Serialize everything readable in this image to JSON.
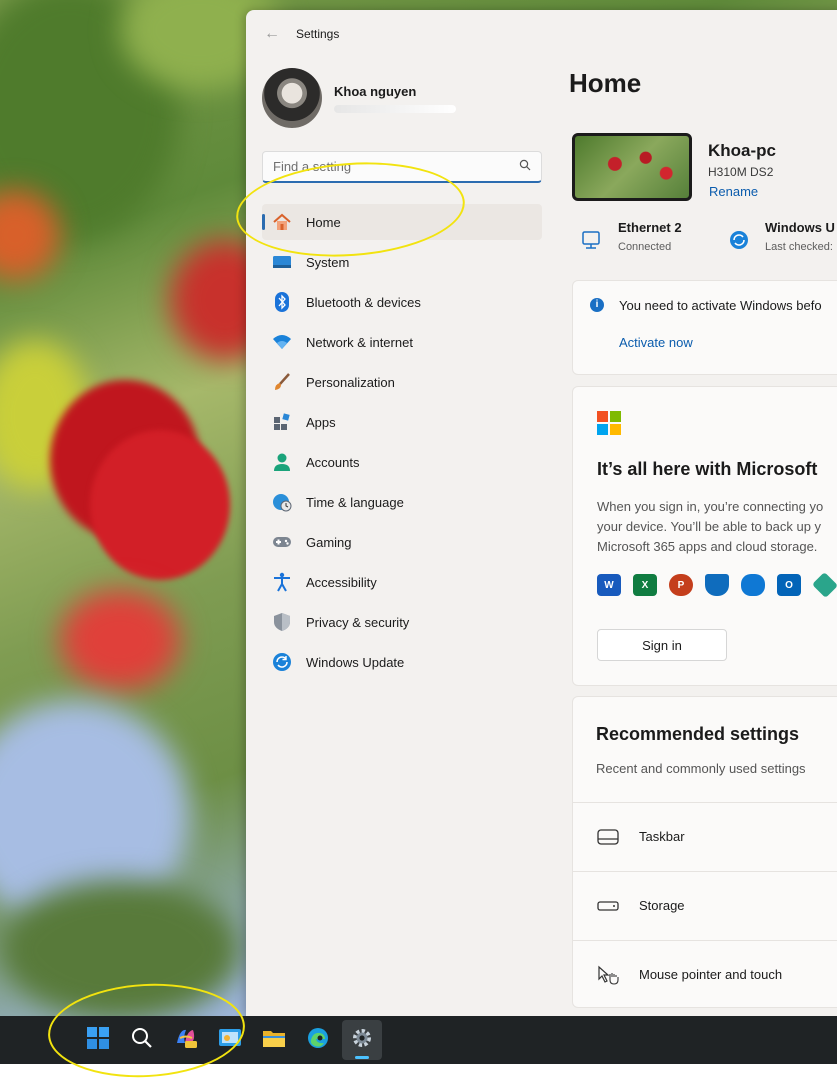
{
  "window": {
    "title": "Settings"
  },
  "profile": {
    "name": "Khoa nguyen"
  },
  "search": {
    "placeholder": "Find a setting"
  },
  "sidebar": {
    "items": [
      {
        "label": "Home",
        "icon": "home-icon"
      },
      {
        "label": "System",
        "icon": "system-icon"
      },
      {
        "label": "Bluetooth & devices",
        "icon": "bluetooth-icon"
      },
      {
        "label": "Network & internet",
        "icon": "wifi-icon"
      },
      {
        "label": "Personalization",
        "icon": "brush-icon"
      },
      {
        "label": "Apps",
        "icon": "apps-icon"
      },
      {
        "label": "Accounts",
        "icon": "accounts-icon"
      },
      {
        "label": "Time & language",
        "icon": "globe-clock-icon"
      },
      {
        "label": "Gaming",
        "icon": "gamepad-icon"
      },
      {
        "label": "Accessibility",
        "icon": "accessibility-icon"
      },
      {
        "label": "Privacy & security",
        "icon": "shield-icon"
      },
      {
        "label": "Windows Update",
        "icon": "update-icon"
      }
    ]
  },
  "main": {
    "title": "Home",
    "device": {
      "name": "Khoa-pc",
      "model": "H310M DS2",
      "rename_label": "Rename"
    },
    "status": [
      {
        "title": "Ethernet 2",
        "subtitle": "Connected",
        "icon": "ethernet-icon"
      },
      {
        "title": "Windows U",
        "subtitle": "Last checked:",
        "icon": "update-icon"
      }
    ],
    "activate": {
      "message": "You need to activate Windows befo",
      "link": "Activate now"
    },
    "microsoft_card": {
      "title": "It’s all here with Microsoft",
      "description_lines": [
        "When you sign in, you’re connecting yo",
        "your device. You’ll be able to back up y",
        "Microsoft 365 apps and cloud storage."
      ],
      "apps": [
        "W",
        "X",
        "P",
        "D",
        "O",
        "O",
        "H"
      ],
      "signin_label": "Sign in"
    },
    "recommended": {
      "title": "Recommended settings",
      "subtitle": "Recent and commonly used settings",
      "items": [
        {
          "label": "Taskbar",
          "icon": "taskbar-icon"
        },
        {
          "label": "Storage",
          "icon": "storage-icon"
        },
        {
          "label": "Mouse pointer and touch",
          "icon": "mouse-pointer-icon"
        }
      ]
    }
  },
  "taskbar": {
    "items": [
      "start-icon",
      "search-icon",
      "copilot-icon",
      "widgets-icon",
      "file-explorer-icon",
      "edge-icon",
      "settings-icon"
    ],
    "active": "settings-icon"
  },
  "colors": {
    "accent": "#2b6cb0",
    "link": "#0b5cad",
    "annotation": "#f2e30f",
    "taskbar": "#1f2325"
  }
}
